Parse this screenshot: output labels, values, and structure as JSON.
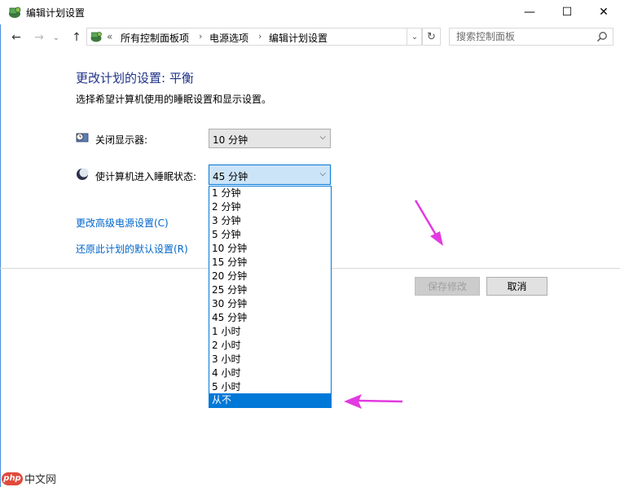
{
  "window": {
    "title": "编辑计划设置",
    "minimize_label": "—",
    "maximize_label": "☐",
    "close_label": "✕"
  },
  "nav": {
    "back": "←",
    "forward": "→",
    "recent": "⌄",
    "up": "↑",
    "breadcrumbs": [
      "所有控制面板项",
      "电源选项",
      "编辑计划设置"
    ],
    "overflow": "«",
    "separator": "›",
    "address_dropdown": "⌄",
    "refresh": "↻",
    "search_placeholder": "搜索控制面板"
  },
  "content": {
    "heading": "更改计划的设置: 平衡",
    "subtext": "选择希望计算机使用的睡眠设置和显示设置。",
    "display_off_label": "关闭显示器:",
    "display_off_value": "10 分钟",
    "sleep_label": "使计算机进入睡眠状态:",
    "sleep_value": "45 分钟",
    "advanced_link": "更改高级电源设置(C)",
    "restore_link": "还原此计划的默认设置(R)",
    "save_button": "保存修改",
    "cancel_button": "取消"
  },
  "dropdown_options": [
    "1 分钟",
    "2 分钟",
    "3 分钟",
    "5 分钟",
    "10 分钟",
    "15 分钟",
    "20 分钟",
    "25 分钟",
    "30 分钟",
    "45 分钟",
    "1 小时",
    "2 小时",
    "3 小时",
    "4 小时",
    "5 小时",
    "从不"
  ],
  "dropdown_highlighted": "从不",
  "watermark": {
    "logo": "php",
    "text": "中文网"
  },
  "colors": {
    "heading": "#1e3287",
    "link": "#0066cc",
    "selection": "#0078d7",
    "annotation_arrow": "#e23ae0"
  }
}
